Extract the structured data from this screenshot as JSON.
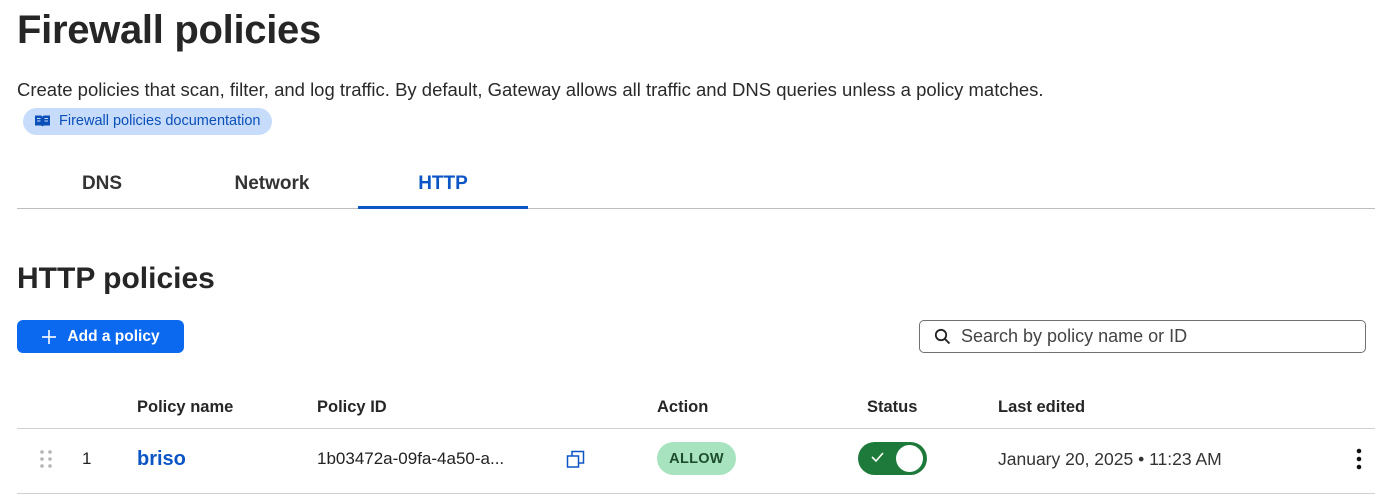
{
  "page": {
    "title": "Firewall policies",
    "description": "Create policies that scan, filter, and log traffic. By default, Gateway allows all traffic and DNS queries unless a policy matches.",
    "doc_link_label": "Firewall policies documentation"
  },
  "tabs": [
    {
      "label": "DNS",
      "active": false
    },
    {
      "label": "Network",
      "active": false
    },
    {
      "label": "HTTP",
      "active": true
    }
  ],
  "section": {
    "title": "HTTP policies",
    "add_button_label": "Add a policy",
    "search_placeholder": "Search by policy name or ID"
  },
  "table": {
    "columns": [
      "Policy name",
      "Policy ID",
      "Action",
      "Status",
      "Last edited"
    ],
    "rows": [
      {
        "index": "1",
        "name": "briso",
        "policy_id": "1b03472a-09fa-4a50-a...",
        "action": "ALLOW",
        "enabled": true,
        "last_edited": "January 20, 2025 • 11:23 AM"
      }
    ]
  },
  "colors": {
    "accent": "#0b55c4",
    "primary_button": "#0b69f0",
    "allow_badge": "#a6e3be",
    "toggle_on": "#1e7a3a",
    "doc_chip": "#c7dcfb"
  }
}
